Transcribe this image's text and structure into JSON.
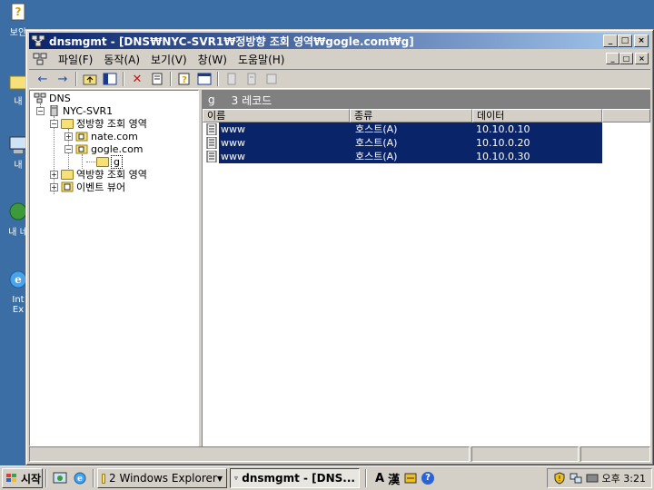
{
  "desktop": {
    "icons": [
      {
        "label": "보안",
        "icon": "help-document-icon"
      },
      {
        "label": "내",
        "icon": "my-documents-icon"
      },
      {
        "label": "내 ",
        "icon": "my-computer-icon"
      },
      {
        "label": "내 네",
        "icon": "network-places-icon"
      },
      {
        "label": "Int\nEx",
        "icon": "internet-explorer-icon"
      }
    ]
  },
  "window": {
    "title": "dnsmgmt - [DNS₩NYC-SVR1₩정방향 조회 영역₩gogle.com₩g]",
    "caption_buttons": [
      "_",
      "□",
      "×"
    ],
    "menu": [
      "파일(F)",
      "동작(A)",
      "보기(V)",
      "창(W)",
      "도움말(H)"
    ]
  },
  "toolbar": {
    "buttons": [
      "back",
      "forward",
      "up-folder",
      "show-hide-tree",
      "delete",
      "export-list",
      "properties",
      "help",
      "new-host",
      "new-alias",
      "new-mail-exchanger"
    ]
  },
  "tree": {
    "root": "DNS",
    "server": "NYC-SVR1",
    "forward_zones": "정방향 조회 영역",
    "zone1": "nate.com",
    "zone2": "gogle.com",
    "subdomain": "g",
    "reverse_zones": "역방향 조회 영역",
    "event_viewer": "이벤트 뷰어"
  },
  "result": {
    "header_name": "g",
    "header_count": "3 레코드",
    "columns": [
      "이름",
      "종류",
      "데이터"
    ],
    "rows": [
      {
        "name": "www",
        "type": "호스트(A)",
        "data": "10.10.0.10"
      },
      {
        "name": "www",
        "type": "호스트(A)",
        "data": "10.10.0.20"
      },
      {
        "name": "www",
        "type": "호스트(A)",
        "data": "10.10.0.30"
      }
    ]
  },
  "taskbar": {
    "start": "시작",
    "tasks": [
      {
        "label": "2 Windows Explorer",
        "active": false
      },
      {
        "label": "dnsmgmt - [DNS...",
        "active": true
      }
    ],
    "ime": [
      "A",
      "漢"
    ],
    "clock": "오후 3:21"
  },
  "colors": {
    "desktop": "#3a6ea5",
    "title_active": "#0a246a",
    "selection": "#0a246a",
    "face": "#d4d0c8"
  }
}
